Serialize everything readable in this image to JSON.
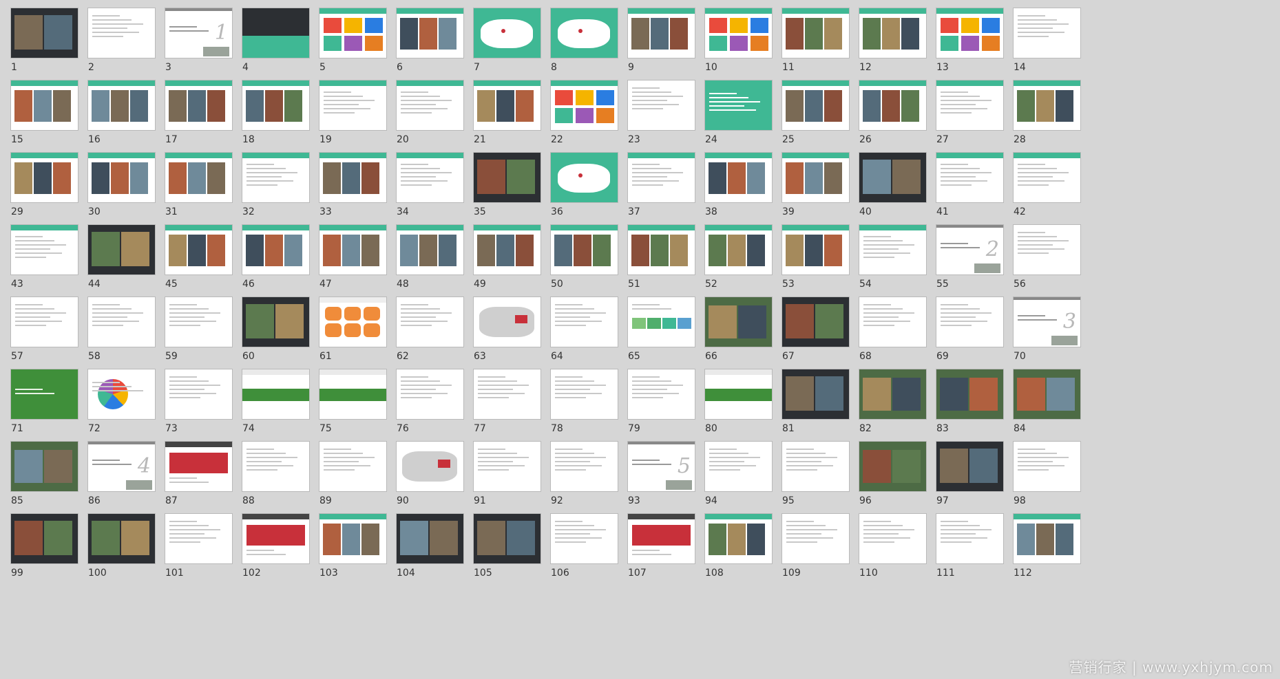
{
  "colors": {
    "background": "#d6d6d6",
    "teal": "#3fb894",
    "green": "#3f8f3a",
    "dark": "#2c2f33",
    "red": "#c8303a",
    "photo": "#6b5a4a"
  },
  "watermark": "营销行家 | www.yxhjym.com",
  "slides": [
    {
      "n": "1",
      "style": "dark-photo"
    },
    {
      "n": "2",
      "style": "white-doc"
    },
    {
      "n": "3",
      "style": "section",
      "big": "1"
    },
    {
      "n": "4",
      "style": "dark-green"
    },
    {
      "n": "5",
      "style": "teal-colorful"
    },
    {
      "n": "6",
      "style": "teal-photo"
    },
    {
      "n": "7",
      "style": "teal-map"
    },
    {
      "n": "8",
      "style": "teal-map"
    },
    {
      "n": "9",
      "style": "teal-photo"
    },
    {
      "n": "10",
      "style": "teal-colorful"
    },
    {
      "n": "11",
      "style": "teal-photo"
    },
    {
      "n": "12",
      "style": "teal-photo"
    },
    {
      "n": "13",
      "style": "teal-colorful"
    },
    {
      "n": "14",
      "style": "white-doc"
    },
    {
      "n": "15",
      "style": "teal-photo"
    },
    {
      "n": "16",
      "style": "teal-photo"
    },
    {
      "n": "17",
      "style": "teal-photo"
    },
    {
      "n": "18",
      "style": "teal-photo"
    },
    {
      "n": "19",
      "style": "teal-doc"
    },
    {
      "n": "20",
      "style": "teal-doc"
    },
    {
      "n": "21",
      "style": "teal-photo"
    },
    {
      "n": "22",
      "style": "teal-colorful"
    },
    {
      "n": "23",
      "style": "white-doc"
    },
    {
      "n": "24",
      "style": "teal-full"
    },
    {
      "n": "25",
      "style": "teal-photo"
    },
    {
      "n": "26",
      "style": "teal-photo"
    },
    {
      "n": "27",
      "style": "teal-doc"
    },
    {
      "n": "28",
      "style": "teal-photo"
    },
    {
      "n": "29",
      "style": "teal-photo"
    },
    {
      "n": "30",
      "style": "teal-photo"
    },
    {
      "n": "31",
      "style": "teal-photo"
    },
    {
      "n": "32",
      "style": "teal-doc"
    },
    {
      "n": "33",
      "style": "teal-photo"
    },
    {
      "n": "34",
      "style": "teal-doc"
    },
    {
      "n": "35",
      "style": "dark-photo"
    },
    {
      "n": "36",
      "style": "teal-map"
    },
    {
      "n": "37",
      "style": "teal-doc"
    },
    {
      "n": "38",
      "style": "teal-photo"
    },
    {
      "n": "39",
      "style": "teal-photo"
    },
    {
      "n": "40",
      "style": "dark-photo"
    },
    {
      "n": "41",
      "style": "teal-doc"
    },
    {
      "n": "42",
      "style": "teal-doc"
    },
    {
      "n": "43",
      "style": "teal-doc"
    },
    {
      "n": "44",
      "style": "dark-photo"
    },
    {
      "n": "45",
      "style": "teal-photo"
    },
    {
      "n": "46",
      "style": "teal-photo"
    },
    {
      "n": "47",
      "style": "teal-photo"
    },
    {
      "n": "48",
      "style": "teal-photo"
    },
    {
      "n": "49",
      "style": "teal-photo"
    },
    {
      "n": "50",
      "style": "teal-photo"
    },
    {
      "n": "51",
      "style": "teal-photo"
    },
    {
      "n": "52",
      "style": "teal-photo"
    },
    {
      "n": "53",
      "style": "teal-photo"
    },
    {
      "n": "54",
      "style": "teal-doc"
    },
    {
      "n": "55",
      "style": "section",
      "big": "2"
    },
    {
      "n": "56",
      "style": "white-doc"
    },
    {
      "n": "57",
      "style": "white-doc"
    },
    {
      "n": "58",
      "style": "white-doc"
    },
    {
      "n": "59",
      "style": "white-doc"
    },
    {
      "n": "60",
      "style": "dark-photo"
    },
    {
      "n": "61",
      "style": "orange-hex"
    },
    {
      "n": "62",
      "style": "white-doc"
    },
    {
      "n": "63",
      "style": "white-map"
    },
    {
      "n": "64",
      "style": "white-doc"
    },
    {
      "n": "65",
      "style": "green-arrow"
    },
    {
      "n": "66",
      "style": "green-photo"
    },
    {
      "n": "67",
      "style": "dark-photo"
    },
    {
      "n": "68",
      "style": "white-doc"
    },
    {
      "n": "69",
      "style": "white-doc"
    },
    {
      "n": "70",
      "style": "section",
      "big": "3"
    },
    {
      "n": "71",
      "style": "green-full"
    },
    {
      "n": "72",
      "style": "white-pie"
    },
    {
      "n": "73",
      "style": "white-doc"
    },
    {
      "n": "74",
      "style": "green-band"
    },
    {
      "n": "75",
      "style": "green-band"
    },
    {
      "n": "76",
      "style": "white-doc"
    },
    {
      "n": "77",
      "style": "white-doc"
    },
    {
      "n": "78",
      "style": "white-doc"
    },
    {
      "n": "79",
      "style": "white-doc"
    },
    {
      "n": "80",
      "style": "green-band"
    },
    {
      "n": "81",
      "style": "dark-photo"
    },
    {
      "n": "82",
      "style": "green-photo"
    },
    {
      "n": "83",
      "style": "green-photo"
    },
    {
      "n": "84",
      "style": "green-photo"
    },
    {
      "n": "85",
      "style": "green-photo"
    },
    {
      "n": "86",
      "style": "section",
      "big": "4"
    },
    {
      "n": "87",
      "style": "red-doc"
    },
    {
      "n": "88",
      "style": "white-doc"
    },
    {
      "n": "89",
      "style": "white-doc"
    },
    {
      "n": "90",
      "style": "white-map"
    },
    {
      "n": "91",
      "style": "white-doc"
    },
    {
      "n": "92",
      "style": "white-doc"
    },
    {
      "n": "93",
      "style": "section",
      "big": "5"
    },
    {
      "n": "94",
      "style": "white-doc"
    },
    {
      "n": "95",
      "style": "white-doc"
    },
    {
      "n": "96",
      "style": "green-photo"
    },
    {
      "n": "97",
      "style": "dark-photo"
    },
    {
      "n": "98",
      "style": "white-doc"
    },
    {
      "n": "99",
      "style": "dark-photo"
    },
    {
      "n": "100",
      "style": "dark-photo"
    },
    {
      "n": "101",
      "style": "white-doc"
    },
    {
      "n": "102",
      "style": "red-doc"
    },
    {
      "n": "103",
      "style": "teal-photo"
    },
    {
      "n": "104",
      "style": "dark-photo"
    },
    {
      "n": "105",
      "style": "dark-photo"
    },
    {
      "n": "106",
      "style": "white-doc"
    },
    {
      "n": "107",
      "style": "red-doc"
    },
    {
      "n": "108",
      "style": "teal-photo"
    },
    {
      "n": "109",
      "style": "white-doc"
    },
    {
      "n": "110",
      "style": "white-doc"
    },
    {
      "n": "111",
      "style": "white-doc"
    },
    {
      "n": "112",
      "style": "teal-photo"
    }
  ]
}
